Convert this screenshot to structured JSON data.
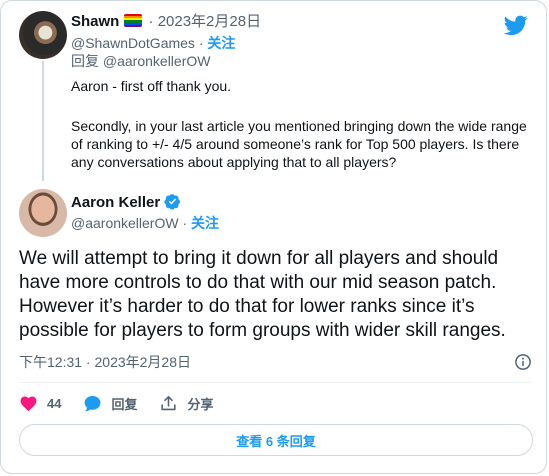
{
  "parent_tweet": {
    "name": "Shawn",
    "date": "2023年2月28日",
    "separator": " · ",
    "handle": "@ShawnDotGames",
    "follow_label": "关注",
    "reply_prefix": "回复",
    "reply_to": "@aaronkellerOW",
    "text_paragraphs": [
      "Aaron - first off thank you.",
      "Secondly, in your last article you mentioned bringing down the wide range of ranking to +/- 4/5 around someone’s rank for Top 500 players. Is there any conversations about applying that to all players?"
    ]
  },
  "main_tweet": {
    "name": "Aaron Keller",
    "handle": "@aaronkellerOW",
    "follow_label": "关注",
    "separator": " · ",
    "text": "We will attempt to bring it down for all players and should have more controls to do that with our mid season patch. However it’s harder to do that for lower ranks since it’s possible for players to form groups with wider skill ranges.",
    "time": "下午12:31",
    "date": "2023年2月28日"
  },
  "actions": {
    "like_count": "44",
    "reply_label": "回复",
    "share_label": "分享"
  },
  "view_replies_label": "查看 6 条回复",
  "colors": {
    "accent": "#1d9bf0",
    "like": "#f91880",
    "muted": "#536471",
    "border": "#cfd9de"
  },
  "icons": [
    "twitter-bird-icon",
    "rainbow-flag-icon",
    "verified-badge-icon",
    "info-icon",
    "heart-icon",
    "reply-bubble-icon",
    "share-icon"
  ]
}
